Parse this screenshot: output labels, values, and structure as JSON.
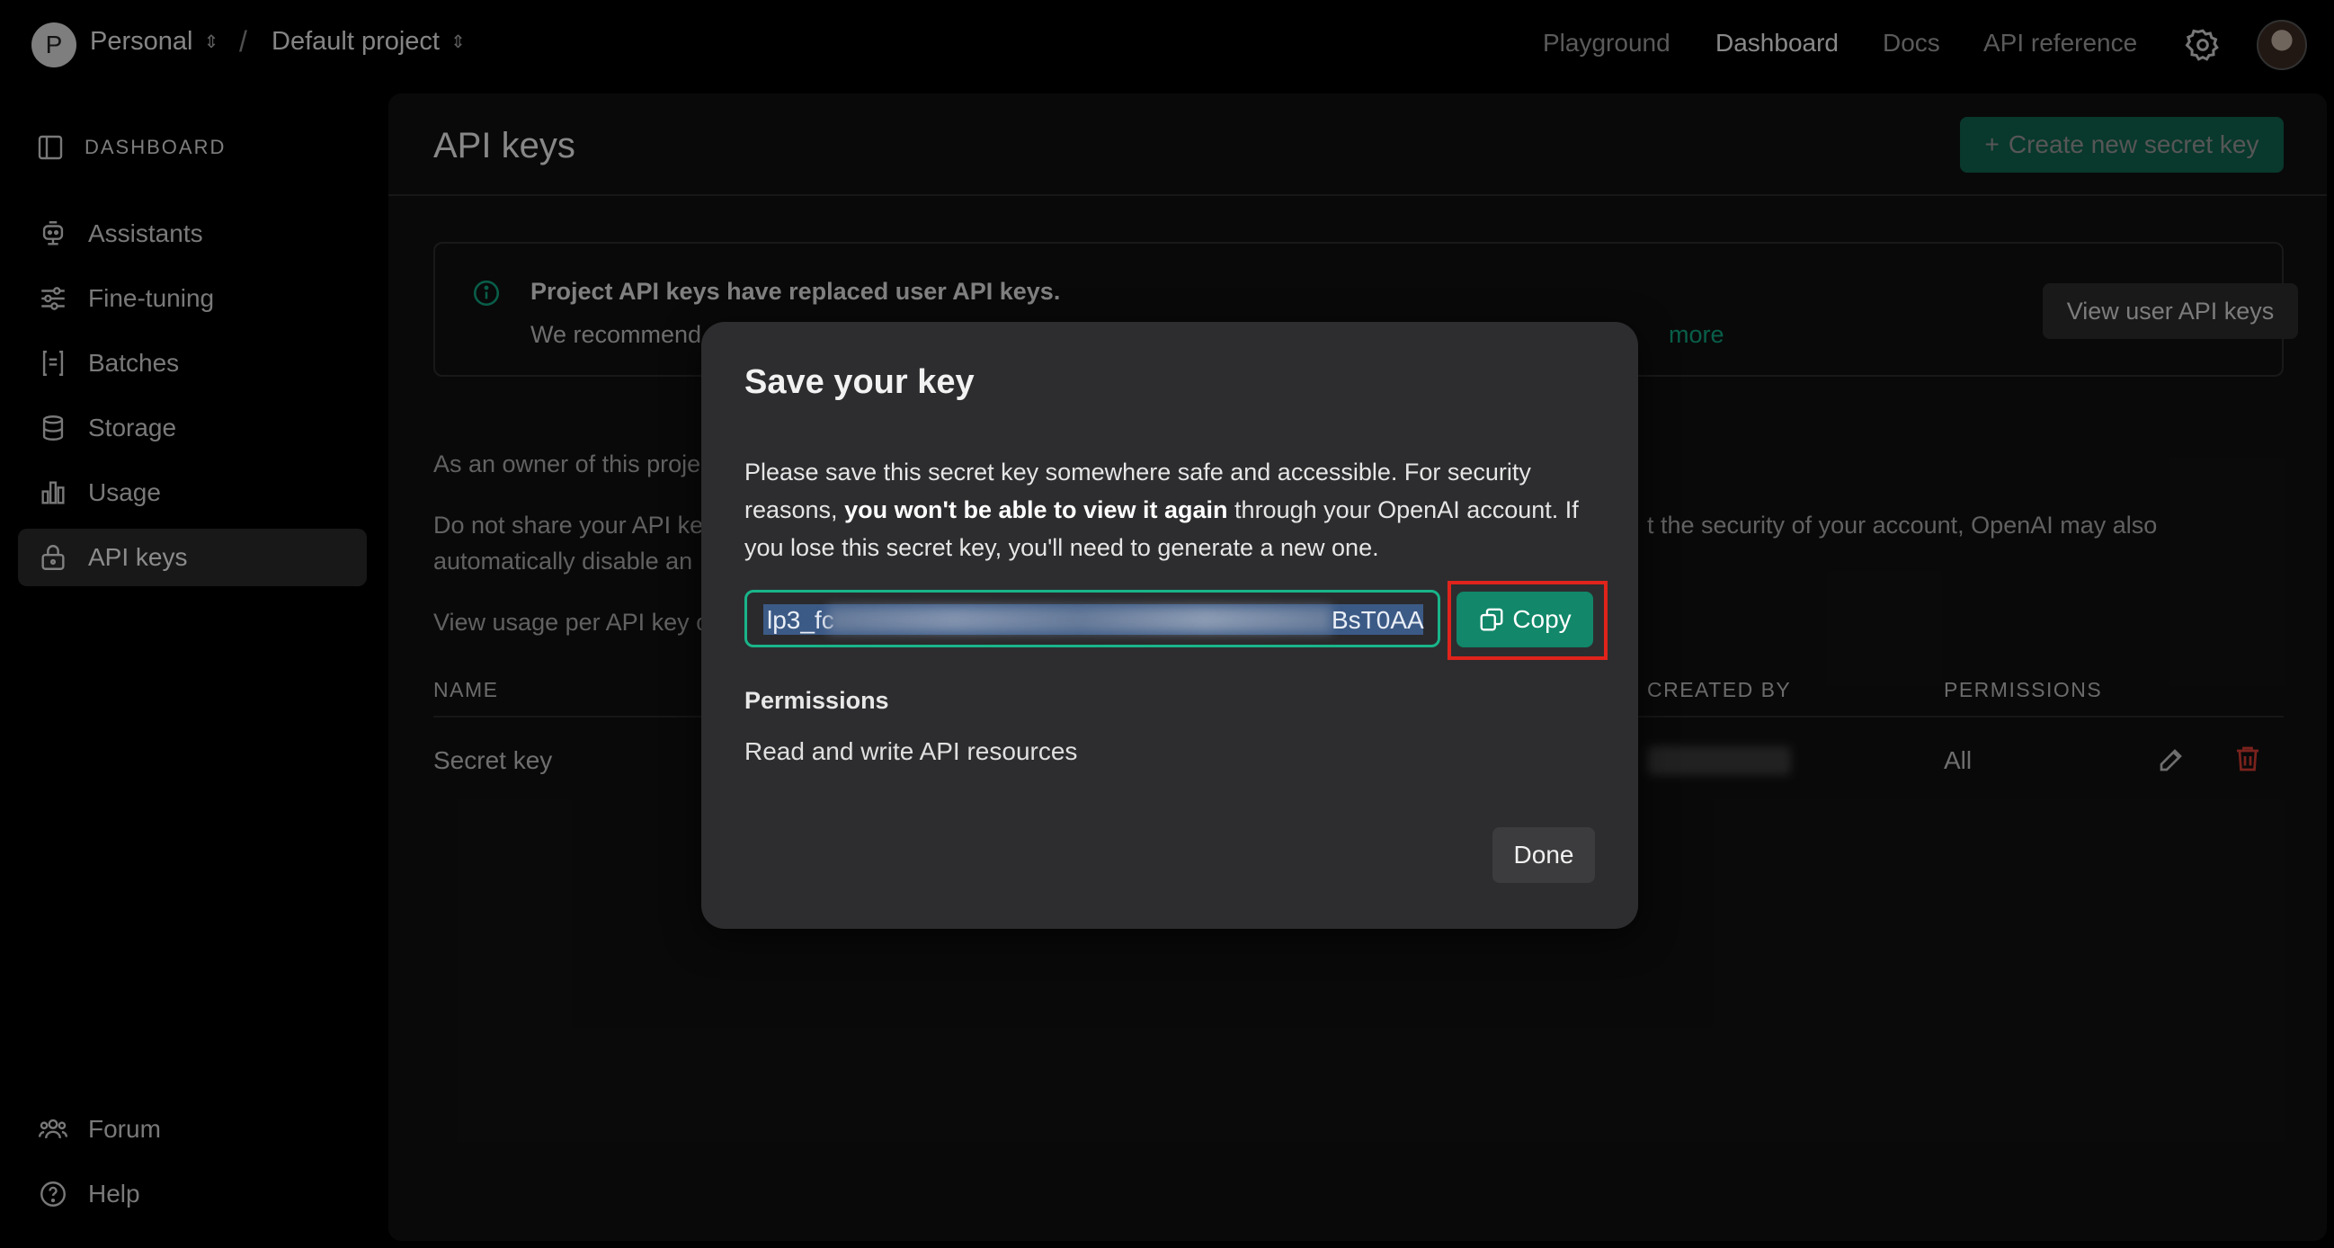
{
  "topbar": {
    "org_initial": "P",
    "org_name": "Personal",
    "separator": "/",
    "project_name": "Default project",
    "nav": [
      "Playground",
      "Dashboard",
      "Docs",
      "API reference"
    ],
    "active_nav": "Dashboard"
  },
  "sidebar": {
    "header": "DASHBOARD",
    "items": [
      {
        "label": "Assistants",
        "icon": "assistant-icon"
      },
      {
        "label": "Fine-tuning",
        "icon": "sliders-icon"
      },
      {
        "label": "Batches",
        "icon": "batches-icon"
      },
      {
        "label": "Storage",
        "icon": "database-icon"
      },
      {
        "label": "Usage",
        "icon": "chart-icon"
      },
      {
        "label": "API keys",
        "icon": "lock-icon",
        "active": true
      }
    ],
    "footer": [
      {
        "label": "Forum",
        "icon": "people-icon"
      },
      {
        "label": "Help",
        "icon": "help-icon"
      }
    ]
  },
  "main": {
    "title": "API keys",
    "create_button": "Create new secret key",
    "banner": {
      "title": "Project API keys have replaced user API keys.",
      "text": "We recommend",
      "link": "more",
      "button": "View user API keys"
    },
    "para1": "As an owner of this proje",
    "para2_line1": "Do not share your API ke",
    "para2_line1_right": "t the security of your account, OpenAI may also",
    "para2_line2": "automatically disable an",
    "para3": "View usage per API key o",
    "columns": {
      "name": "NAME",
      "created_by": "CREATED BY",
      "permissions": "PERMISSIONS"
    },
    "row": {
      "name": "Secret key",
      "permissions": "All"
    }
  },
  "modal": {
    "title": "Save your key",
    "desc_part1": "Please save this secret key somewhere safe and accessible. For security reasons, ",
    "desc_bold": "you won't be able to view it again",
    "desc_part2": " through your OpenAI account. If you lose this secret key, you'll need to generate a new one.",
    "key_prefix": "lp3_fc",
    "key_suffix": "BsT0AA",
    "copy_button": "Copy",
    "permissions_label": "Permissions",
    "permissions_value": "Read and write API resources",
    "done_button": "Done"
  },
  "colors": {
    "accent": "#10a37f",
    "highlight": "#e0241b",
    "background": "#000000"
  }
}
